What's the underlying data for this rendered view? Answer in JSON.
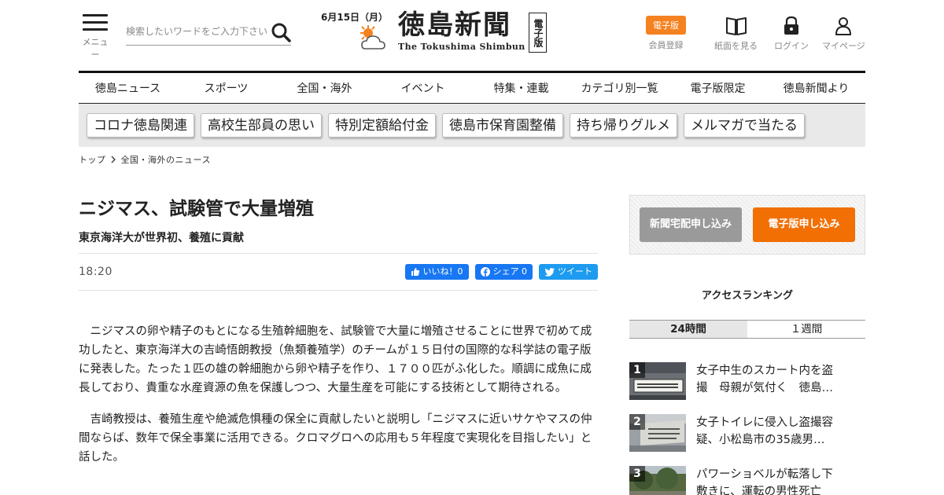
{
  "header": {
    "menu_label": "メニュー",
    "search_placeholder": "検索したいワードをご入力下さい",
    "date": "6月15日（月）",
    "logo_main": "徳島新聞",
    "logo_sub": "The Tokushima Shimbun",
    "logo_tag": "電子版",
    "edition_badge": "電子版",
    "member_label": "会員登録",
    "paper_label": "紙面を見る",
    "login_label": "ログイン",
    "mypage_label": "マイページ"
  },
  "nav": {
    "items": [
      "徳島ニュース",
      "スポーツ",
      "全国・海外",
      "イベント",
      "特集・連載",
      "カテゴリ別一覧",
      "電子版限定",
      "徳島新聞より"
    ]
  },
  "tags": [
    "コロナ徳島関連",
    "高校生部員の思い",
    "特別定額給付金",
    "徳島市保育園整備",
    "持ち帰りグルメ",
    "メルマガで当たる"
  ],
  "breadcrumb": [
    "トップ",
    "全国・海外のニュース"
  ],
  "article": {
    "headline": "ニジマス、試験管で大量増殖",
    "subhead": "東京海洋大が世界初、養殖に貢献",
    "time": "18:20",
    "like_label": "いいね！0",
    "share_label": "シェア 0",
    "tweet_label": "ツイート",
    "paragraphs": [
      "ニジマスの卵や精子のもとになる生殖幹細胞を、試験管で大量に増殖させることに世界で初めて成功したと、東京海洋大の吉崎悟朗教授（魚類養殖学）のチームが１５日付の国際的な科学誌の電子版に発表した。たった１匹の雄の幹細胞から卵や精子を作り、１７００匹がふ化した。順調に成魚に成長しており、貴重な水産資源の魚を保護しつつ、大量生産を可能にする技術として期待される。",
      "吉崎教授は、養殖生産や絶滅危惧種の保全に貢献したいと説明し「ニジマスに近いサケやマスの仲間ならば、数年で保全事業に活用できる。クロマグロへの応用も５年程度で実現化を目指したい」と話した。"
    ]
  },
  "sidebar": {
    "delivery_button": "新聞宅配申し込み",
    "digital_button": "電子版申し込み",
    "ranking_title": "アクセスランキング",
    "tab_24h": "24時間",
    "tab_week": "１週間",
    "ranking": [
      {
        "rank": "1",
        "title": "女子中生のスカート内を盗撮　母親が気付く　徳島…"
      },
      {
        "rank": "2",
        "title": "女子トイレに侵入し盗撮容疑、小松島市の35歳男…"
      },
      {
        "rank": "3",
        "title": "パワーショベルが転落し下敷きに、運転の男性死亡"
      }
    ]
  },
  "colors": {
    "accent_orange": "#f26f04",
    "facebook_blue": "#1877f2",
    "twitter_blue": "#1d9bf0"
  }
}
